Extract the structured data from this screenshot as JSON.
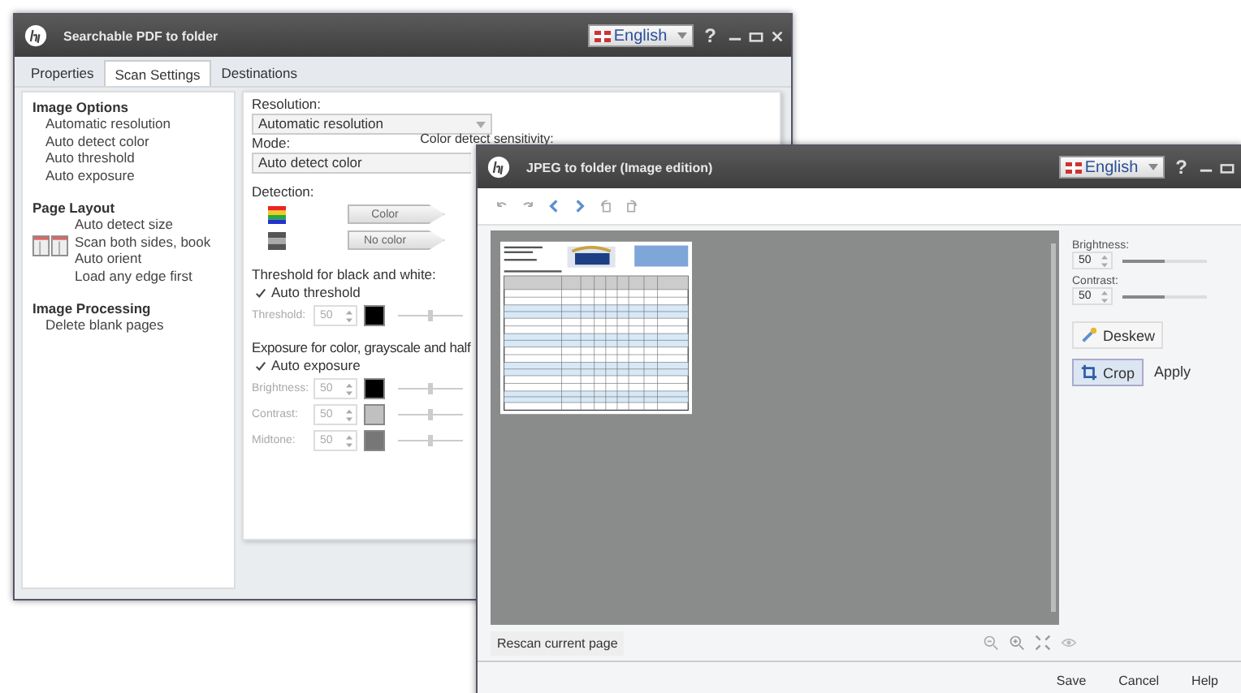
{
  "back_window": {
    "title": "Searchable PDF to folder",
    "language": "English",
    "help": "?",
    "tabs": [
      {
        "label": "Properties",
        "selected": false
      },
      {
        "label": "Scan Settings",
        "selected": true
      },
      {
        "label": "Destinations",
        "selected": false
      }
    ],
    "option_sections": [
      {
        "heading": "Image Options",
        "items": [
          "Automatic resolution",
          "Auto detect color",
          "Auto threshold",
          "Auto exposure"
        ]
      },
      {
        "heading": "Page Layout",
        "items": [
          "Auto detect size",
          "Scan both sides, book",
          "Auto orient",
          "Load any edge first"
        ]
      },
      {
        "heading": "Image Processing",
        "items": [
          "Delete blank pages"
        ]
      }
    ],
    "resolution": {
      "label": "Resolution:",
      "value": "Automatic resolution"
    },
    "mode": {
      "label": "Mode:",
      "value": "Auto detect color"
    },
    "sensitivity_label": "Color detect sensitivity:",
    "detection": {
      "label": "Detection:",
      "rows": [
        {
          "kind": "color",
          "button": "Color"
        },
        {
          "kind": "gray",
          "button": "No color"
        }
      ]
    },
    "threshold": {
      "heading": "Threshold for black and white:",
      "auto": {
        "label": "Auto threshold",
        "checked": true
      },
      "rows": [
        {
          "label": "Threshold:",
          "value": "50",
          "color": "#000000",
          "disabled": true,
          "level": 0.5
        }
      ]
    },
    "exposure": {
      "heading": "Exposure for color, grayscale and half",
      "auto": {
        "label": "Auto exposure",
        "checked": true
      },
      "rows": [
        {
          "label": "Brightness:",
          "value": "50",
          "color": "#000000",
          "disabled": true,
          "level": 0.5
        },
        {
          "label": "Contrast:",
          "value": "50",
          "color": "#c0c0c0",
          "disabled": true,
          "level": 0.5
        },
        {
          "label": "Midtone:",
          "value": "50",
          "color": "#777777",
          "disabled": true,
          "level": 0.5
        }
      ]
    }
  },
  "front_window": {
    "title": "JPEG to folder (Image edition)",
    "language": "English",
    "help": "?",
    "adjustments": [
      {
        "label": "Brightness:",
        "value": "50",
        "level": 0.5
      },
      {
        "label": "Contrast:",
        "value": "50",
        "level": 0.5
      }
    ],
    "deskew": "Deskew",
    "crop": {
      "label": "Crop",
      "selected": true
    },
    "apply": "Apply",
    "rescan": "Rescan current page",
    "buttons": [
      "Save",
      "Cancel",
      "Help"
    ]
  }
}
